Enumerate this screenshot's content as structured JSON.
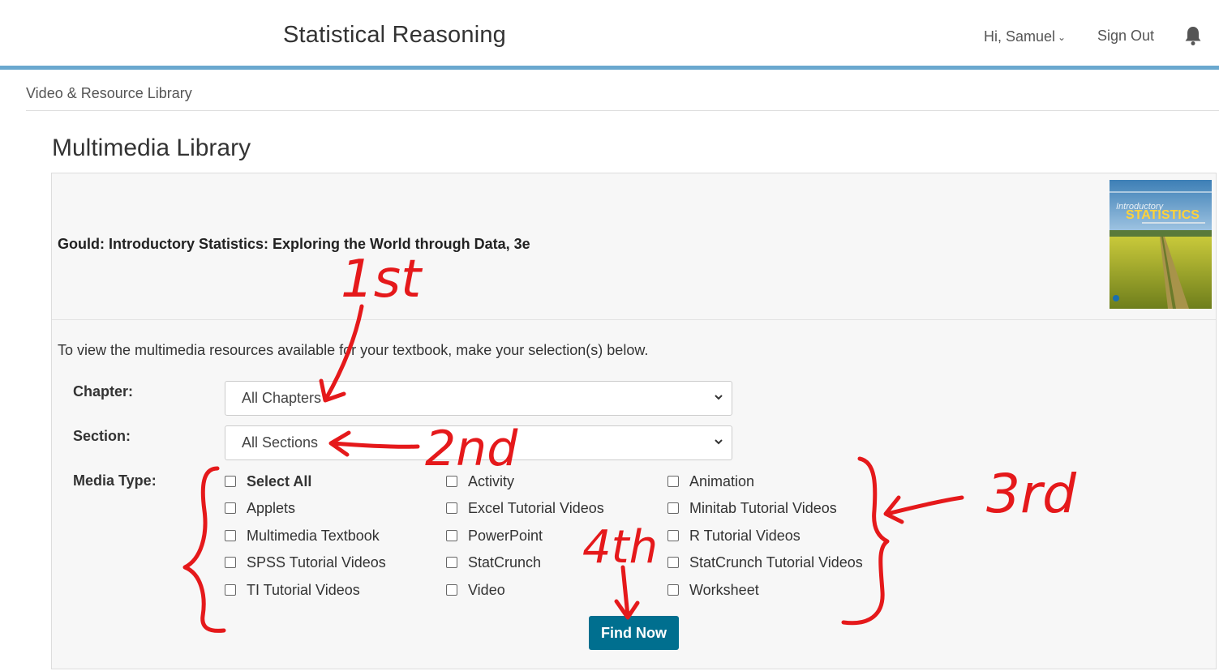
{
  "header": {
    "app_title": "Statistical Reasoning",
    "user_greeting": "Hi, Samuel",
    "sign_out": "Sign Out"
  },
  "breadcrumb": "Video & Resource Library",
  "page_title": "Multimedia Library",
  "book": {
    "title": "Gould: Introductory Statistics: Exploring the World through Data, 3e"
  },
  "form": {
    "instructions": "To view the multimedia resources available for your textbook, make your selection(s) below.",
    "chapter_label": "Chapter:",
    "chapter_value": "All Chapters",
    "section_label": "Section:",
    "section_value": "All Sections",
    "media_type_label": "Media Type:",
    "media_types": [
      "Select All",
      "Activity",
      "Animation",
      "Applets",
      "Excel Tutorial Videos",
      "Minitab Tutorial Videos",
      "Multimedia Textbook",
      "PowerPoint",
      "R Tutorial Videos",
      "SPSS Tutorial Videos",
      "StatCrunch",
      "StatCrunch Tutorial Videos",
      "TI Tutorial Videos",
      "Video",
      "Worksheet"
    ],
    "submit_label": "Find Now"
  },
  "annotations": {
    "first": "1st",
    "second": "2nd",
    "third": "3rd",
    "fourth": "4th",
    "ink_color": "#e5191b"
  },
  "colors": {
    "accent_rule": "#6aa8cf",
    "button": "#006f8f"
  }
}
